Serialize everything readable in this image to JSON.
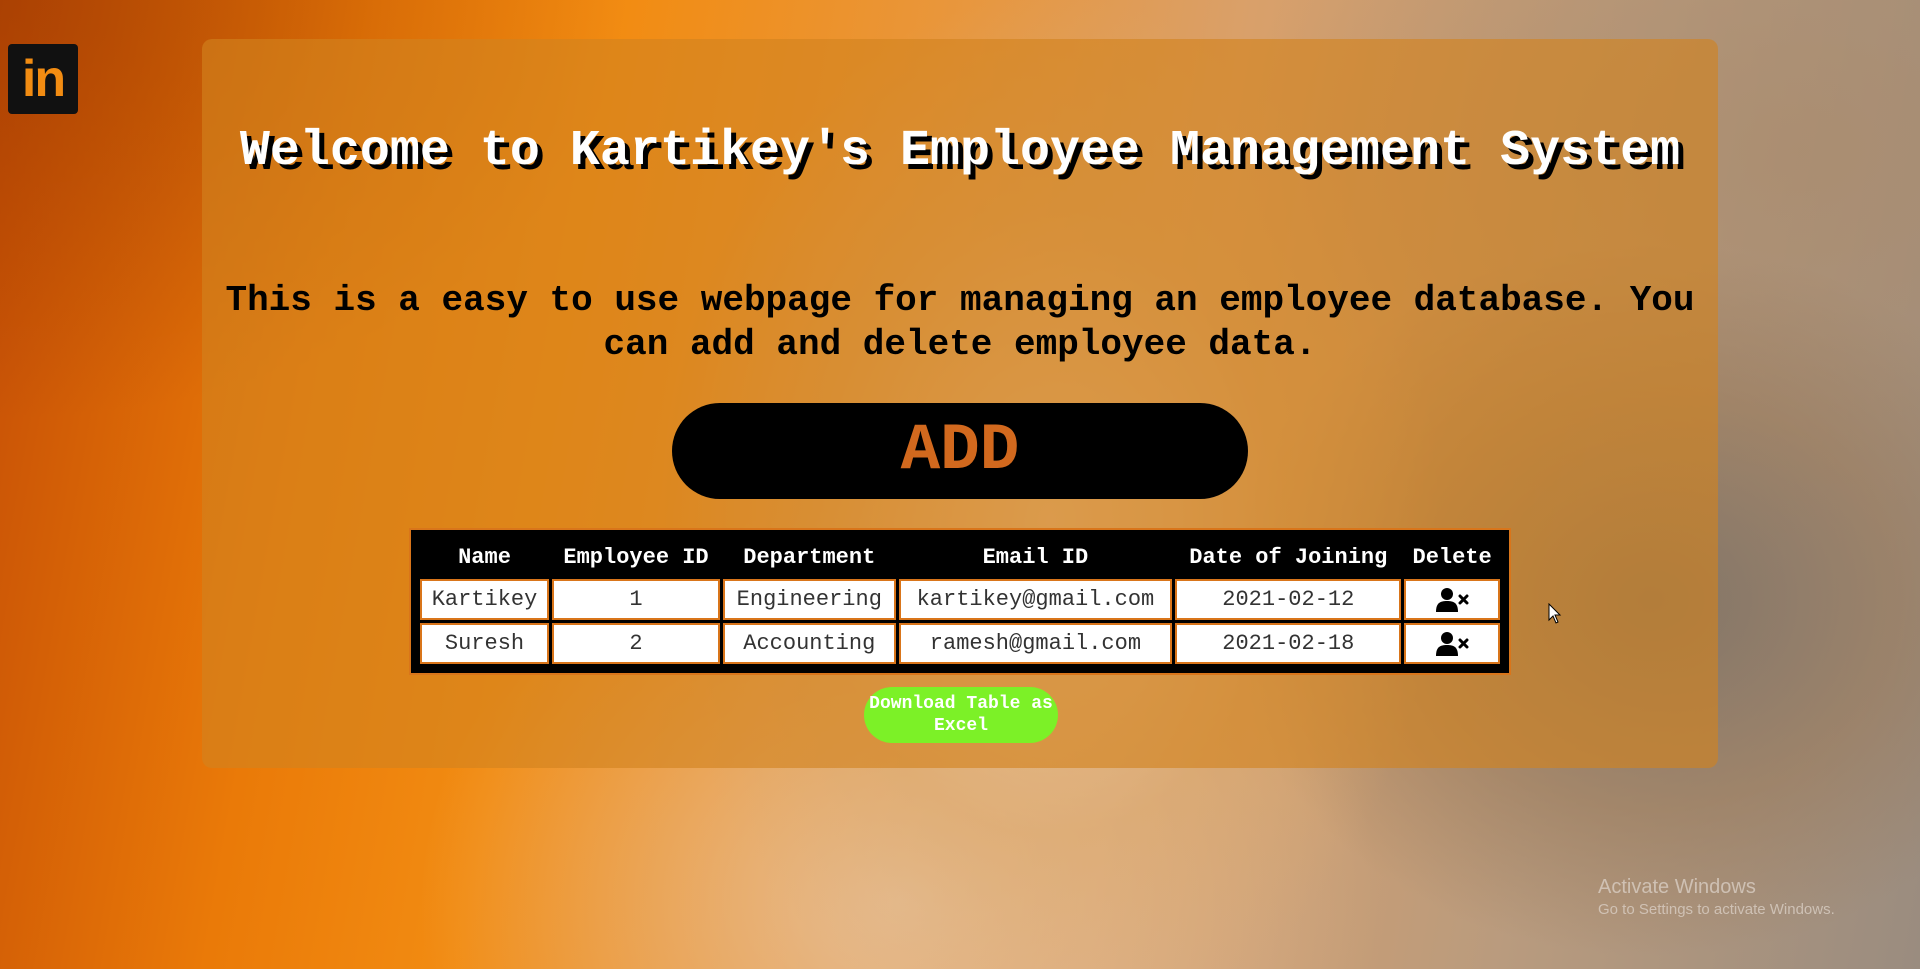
{
  "social": {
    "linkedin_label": "in"
  },
  "header": {
    "title": "Welcome to Kartikey's Employee Management System",
    "subtitle": "This is a easy to use webpage for managing an employee database. You can add and delete employee data."
  },
  "actions": {
    "add_label": "ADD",
    "download_label": "Download Table as Excel"
  },
  "table": {
    "columns": [
      "Name",
      "Employee ID",
      "Department",
      "Email ID",
      "Date of Joining",
      "Delete"
    ],
    "rows": [
      {
        "name": "Kartikey",
        "employee_id": "1",
        "department": "Engineering",
        "email": "kartikey@gmail.com",
        "date_of_joining": "2021-02-12",
        "delete_icon": "user-delete-icon"
      },
      {
        "name": "Suresh",
        "employee_id": "2",
        "department": "Accounting",
        "email": "ramesh@gmail.com",
        "date_of_joining": "2021-02-18",
        "delete_icon": "user-delete-icon"
      }
    ]
  },
  "watermark": {
    "title": "Activate Windows",
    "subtitle": "Go to Settings to activate Windows."
  },
  "colors": {
    "panel": "#d2821e",
    "add_text": "#d2691e",
    "download_bg": "#7cf127",
    "table_border": "#d9751a"
  }
}
